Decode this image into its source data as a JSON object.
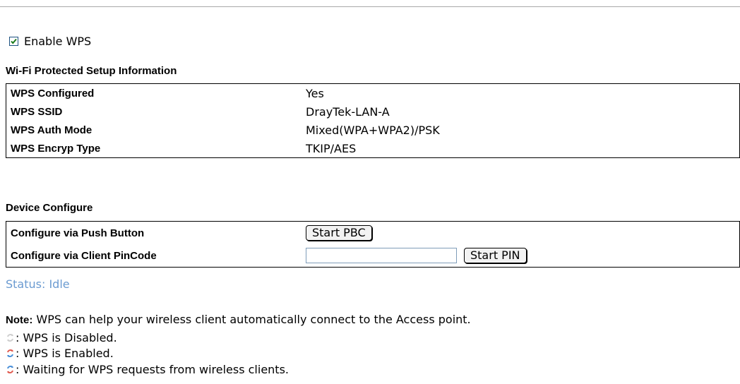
{
  "enable_wps": {
    "label": "Enable WPS",
    "checked": true
  },
  "info": {
    "title": "Wi-Fi Protected Setup Information",
    "rows": [
      {
        "key": "WPS Configured",
        "value": "Yes"
      },
      {
        "key": "WPS SSID",
        "value": "DrayTek-LAN-A"
      },
      {
        "key": "WPS Auth Mode",
        "value": "Mixed(WPA+WPA2)/PSK"
      },
      {
        "key": "WPS Encryp Type",
        "value": "TKIP/AES"
      }
    ]
  },
  "device": {
    "title": "Device Configure",
    "push_label": "Configure via Push Button",
    "push_button": "Start PBC",
    "pin_label": "Configure via Client PinCode",
    "pin_value": "",
    "pin_button": "Start PIN"
  },
  "status": "Status: Idle",
  "note": {
    "prefix": "Note:",
    "text": " WPS can help your wireless client automatically connect to the Access point.",
    "legend": [
      {
        "icon": "wps-disabled-icon",
        "text": ": WPS is Disabled.",
        "color": "#cfcfcf"
      },
      {
        "icon": "wps-enabled-icon",
        "text": ": WPS is Enabled.",
        "color": "#e05a4f"
      },
      {
        "icon": "wps-waiting-icon",
        "text": ": Waiting for WPS requests from wireless clients.",
        "color": "#e05a4f"
      }
    ]
  },
  "colors": {
    "status_text": "#6b9bd1",
    "divider": "#a9a9a9"
  }
}
